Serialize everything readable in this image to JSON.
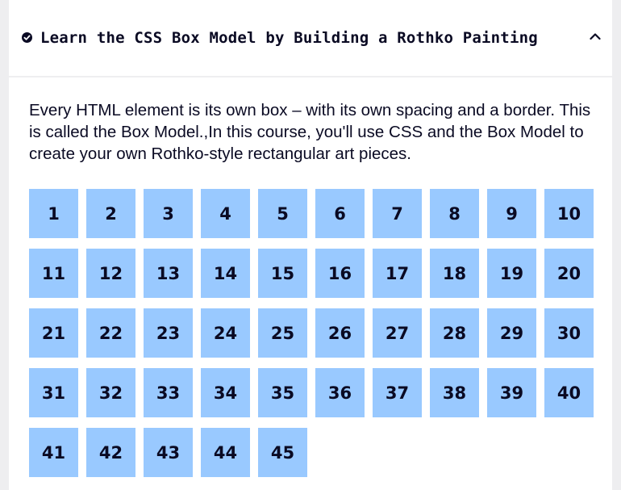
{
  "block": {
    "title": "Learn the CSS Box Model by Building a Rothko Painting",
    "completed_icon": "check-circle-icon",
    "toggle_icon": "chevron-up-icon",
    "description": "Every HTML element is its own box – with its own spacing and a border. This is called the Box Model.,In this course, you'll use CSS and the Box Model to create your own Rothko-style rectangular art pieces."
  },
  "steps": [
    "1",
    "2",
    "3",
    "4",
    "5",
    "6",
    "7",
    "8",
    "9",
    "10",
    "11",
    "12",
    "13",
    "14",
    "15",
    "16",
    "17",
    "18",
    "19",
    "20",
    "21",
    "22",
    "23",
    "24",
    "25",
    "26",
    "27",
    "28",
    "29",
    "30",
    "31",
    "32",
    "33",
    "34",
    "35",
    "36",
    "37",
    "38",
    "39",
    "40",
    "41",
    "42",
    "43",
    "44",
    "45"
  ],
  "colors": {
    "step_background": "#99c9ff",
    "text": "#0a0a23",
    "page_background": "#eeeef0",
    "card_background": "#ffffff"
  }
}
